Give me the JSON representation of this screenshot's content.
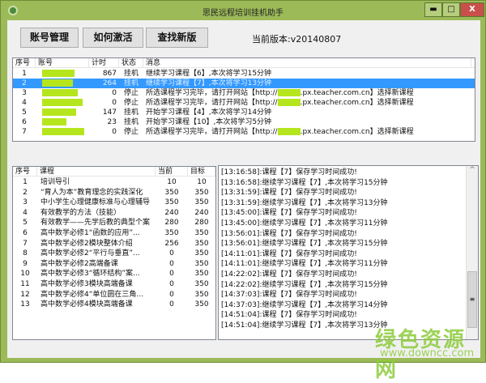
{
  "window": {
    "title": "思民远程培训挂机助手",
    "min": "▬",
    "max": "□",
    "close": "X"
  },
  "toolbar": {
    "account_label": "账号管理",
    "activate_label": "如何激活",
    "update_label": "查找新版",
    "version": "当前版本:v20140807"
  },
  "accounts": {
    "headers": [
      "序号",
      "账号",
      "计时",
      "状态",
      "消息"
    ],
    "rows": [
      {
        "no": "1",
        "time": "867",
        "status": "挂机",
        "msg": "继续学习课程【6】,本次将学习15分钟",
        "url": false
      },
      {
        "no": "2",
        "time": "264",
        "status": "挂机",
        "msg": "继续学习课程【7】,本次将学习13分钟",
        "url": false,
        "selected": true
      },
      {
        "no": "3",
        "time": "0",
        "status": "停止",
        "msg": "所选课程学习完毕，请打开网站【http://",
        "msg2": ".px.teacher.com.cn】选择新课程",
        "url": true
      },
      {
        "no": "4",
        "time": "0",
        "status": "停止",
        "msg": "所选课程学习完毕，请打开网站【http://",
        "msg2": ".px.teacher.com.cn】选择新课程",
        "url": true
      },
      {
        "no": "5",
        "time": "147",
        "status": "挂机",
        "msg": "开始学习课程【4】,本次将学习14分钟",
        "url": false
      },
      {
        "no": "6",
        "time": "23",
        "status": "挂机",
        "msg": "开始学习课程【10】,本次将学习5分钟",
        "url": false
      },
      {
        "no": "7",
        "time": "0",
        "status": "停止",
        "msg": "所选课程学习完毕，请打开网站【http://",
        "msg2": ".px.teacher.com.cn】选择新课程",
        "url": true
      }
    ]
  },
  "courses": {
    "headers": [
      "序号",
      "课程",
      "当前",
      "目标"
    ],
    "rows": [
      [
        "1",
        "培训导引",
        "10",
        "10"
      ],
      [
        "2",
        "“育人为本”教育理念的实践深化",
        "350",
        "350"
      ],
      [
        "3",
        "中小学生心理健康标准与心理辅导",
        "350",
        "350"
      ],
      [
        "4",
        "有效教学的方法（技能）",
        "240",
        "240"
      ],
      [
        "5",
        "有效教学——先学后教的典型个案",
        "280",
        "280"
      ],
      [
        "6",
        "高中数学必修1“函数的应用”...",
        "350",
        "350"
      ],
      [
        "7",
        "高中数学必修2模块整体介绍",
        "256",
        "350"
      ],
      [
        "8",
        "高中数学必修2“平行与垂直”...",
        "0",
        "350"
      ],
      [
        "9",
        "高中数学必修2高端备课",
        "0",
        "350"
      ],
      [
        "10",
        "高中数学必修3“循环结构”案...",
        "0",
        "350"
      ],
      [
        "11",
        "高中数学必修3模块高端备课",
        "0",
        "350"
      ],
      [
        "12",
        "高中数学必修4“单位圆在三角...",
        "0",
        "350"
      ],
      [
        "13",
        "高中数学必修4模块高端备课",
        "0",
        "350"
      ]
    ]
  },
  "log": [
    "[13:16:58]:课程【7】保存学习时间成功!",
    "[13:16:58]:继续学习课程【7】,本次将学习15分钟",
    "[13:31:59]:课程【7】保存学习时间成功!",
    "[13:31:59]:继续学习课程【7】,本次将学习13分钟",
    "[13:45:00]:课程【7】保存学习时间成功!",
    "[13:45:00]:继续学习课程【7】,本次将学习11分钟",
    "[13:56:01]:课程【7】保存学习时间成功!",
    "[13:56:01]:继续学习课程【7】,本次将学习15分钟",
    "[14:11:01]:课程【7】保存学习时间成功!",
    "[14:11:01]:继续学习课程【7】,本次将学习11分钟",
    "[14:22:02]:课程【7】保存学习时间成功!",
    "[14:22:02]:继续学习课程【7】,本次将学习15分钟",
    "[14:37:03]:课程【7】保存学习时间成功!",
    "[14:37:03]:继续学习课程【7】,本次将学习14分钟",
    "[14:51:04]:课程【7】保存学习时间成功!",
    "[14:51:04]:继续学习课程【7】,本次将学习13分钟"
  ],
  "scroll": {
    "up": "^",
    "grip": "≡"
  },
  "watermark": {
    "name": "绿色资源网",
    "url": "www.downcc.com"
  },
  "colors": {
    "frame": "#9cba58",
    "selection": "#3399ff",
    "redaction": "#b5e61d"
  }
}
